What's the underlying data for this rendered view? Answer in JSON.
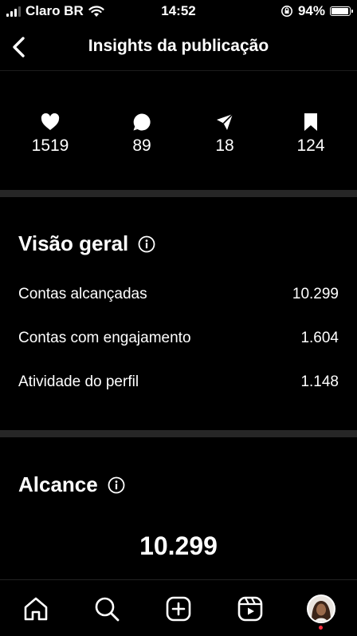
{
  "status_bar": {
    "carrier": "Claro BR",
    "time": "14:52",
    "battery": "94%",
    "battery_level": 0.94
  },
  "header": {
    "title": "Insights da publicação"
  },
  "stats": [
    {
      "icon": "heart-icon",
      "value": "1519"
    },
    {
      "icon": "comment-icon",
      "value": "89"
    },
    {
      "icon": "send-icon",
      "value": "18"
    },
    {
      "icon": "bookmark-icon",
      "value": "124"
    }
  ],
  "overview": {
    "title": "Visão geral",
    "rows": [
      {
        "label": "Contas alcançadas",
        "value": "10.299"
      },
      {
        "label": "Contas com engajamento",
        "value": "1.604"
      },
      {
        "label": "Atividade do perfil",
        "value": "1.148"
      }
    ]
  },
  "reach": {
    "title": "Alcance",
    "value": "10.299"
  },
  "tab_bar": {
    "tabs": [
      "home-icon",
      "search-icon",
      "create-icon",
      "reels-icon",
      "profile-avatar"
    ]
  },
  "colors": {
    "background": "#000000",
    "divider": "#262626",
    "notification": "#ff3040"
  }
}
